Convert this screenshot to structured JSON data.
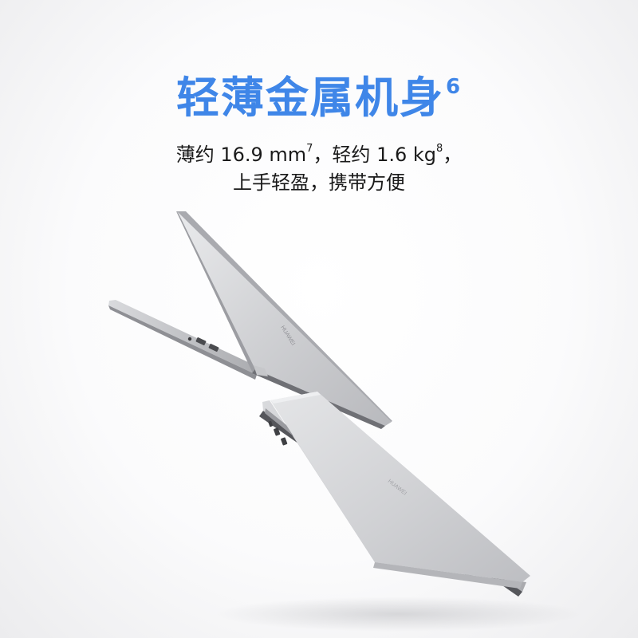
{
  "hero": {
    "title": "轻薄金属机身",
    "title_note": "6"
  },
  "spec_line": {
    "thin_prefix": "薄约 16.9 mm",
    "thin_note": "7",
    "weight_prefix": "，轻约 1.6 kg",
    "weight_note": "8",
    "end_punct": "，"
  },
  "tagline": {
    "text": "上手轻盈，携带方便"
  },
  "colors": {
    "title_blue": "#3f86e8",
    "body_text": "#1a1a1a",
    "laptop_silver": "#c9cacd"
  },
  "product": {
    "icon": "laptop-icon"
  }
}
